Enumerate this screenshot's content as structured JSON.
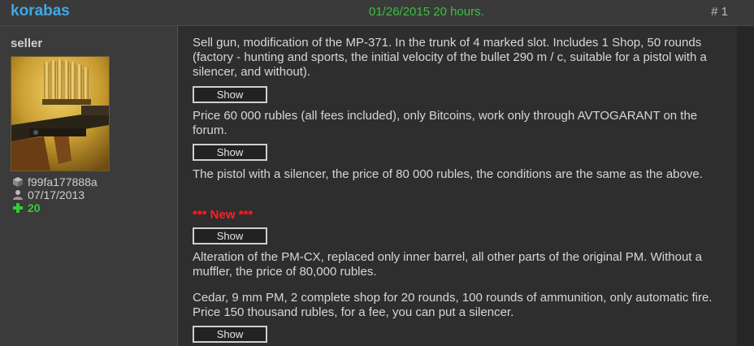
{
  "post": {
    "author": "korabas",
    "date": "01/26/2015 20 hours.",
    "number": "# 1"
  },
  "sidebar": {
    "role": "seller",
    "user_id": "f99fa177888a",
    "joined": "07/17/2013",
    "reputation": "20"
  },
  "content": {
    "para1": "Sell gun, modification of the MP-371. In the trunk of 4 marked slot. Includes 1 Shop, 50 rounds (factory - hunting and sports, the initial velocity of the bullet 290 m / c, suitable for a pistol with a silencer, and without).",
    "show_label": "Show",
    "para2": "Price 60 000 rubles (all fees included), only Bitcoins, work only through AVTOGARANT on the forum.",
    "para3": "The pistol with a silencer, the price of 80 000 rubles, the conditions are the same as the above.",
    "new_tag": "*** New ***",
    "para4": "Alteration of the PM-CX, replaced only inner barrel, all other parts of the original PM. Without a muffler, the price of 80,000 rubles.",
    "para5": "Cedar, 9 mm PM, 2 complete shop for 20 rounds, 100 rounds of ammunition, only automatic fire. Price 150 thousand rubles, for a fee, you can put a silencer."
  },
  "colors": {
    "author": "#3fa9e6",
    "date": "#3cbf3c",
    "new_tag": "#ff2020",
    "reputation": "#33cc33"
  },
  "icons": [
    "cube-icon",
    "user-icon",
    "plus-icon"
  ]
}
